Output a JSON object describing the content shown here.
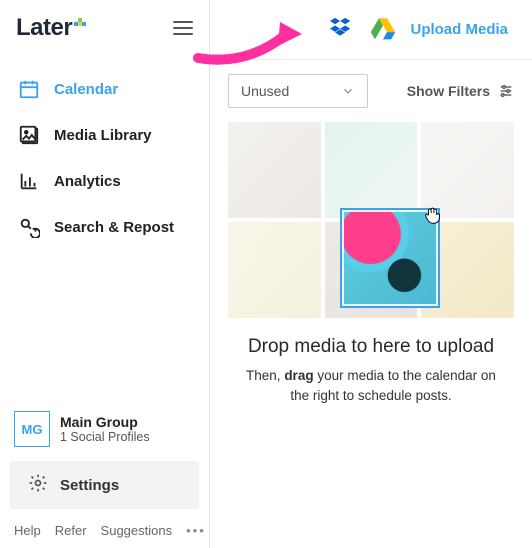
{
  "brand": {
    "name": "Later"
  },
  "sidebar": {
    "items": [
      {
        "label": "Calendar"
      },
      {
        "label": "Media Library"
      },
      {
        "label": "Analytics"
      },
      {
        "label": "Search & Repost"
      }
    ],
    "group": {
      "avatar_initials": "MG",
      "name": "Main Group",
      "sub": "1 Social Profiles"
    },
    "settings_label": "Settings",
    "footer": {
      "help": "Help",
      "refer": "Refer",
      "suggestions": "Suggestions"
    }
  },
  "topbar": {
    "upload_label": "Upload Media"
  },
  "filter": {
    "selected": "Unused",
    "show_filters_label": "Show Filters"
  },
  "dropzone": {
    "headline": "Drop media to here to upload",
    "sub_prefix": "Then, ",
    "sub_bold": "drag",
    "sub_suffix": " your media to the calendar on the right to schedule posts."
  },
  "colors": {
    "accent": "#3ba3ee",
    "arrow": "#ff2ea1"
  }
}
